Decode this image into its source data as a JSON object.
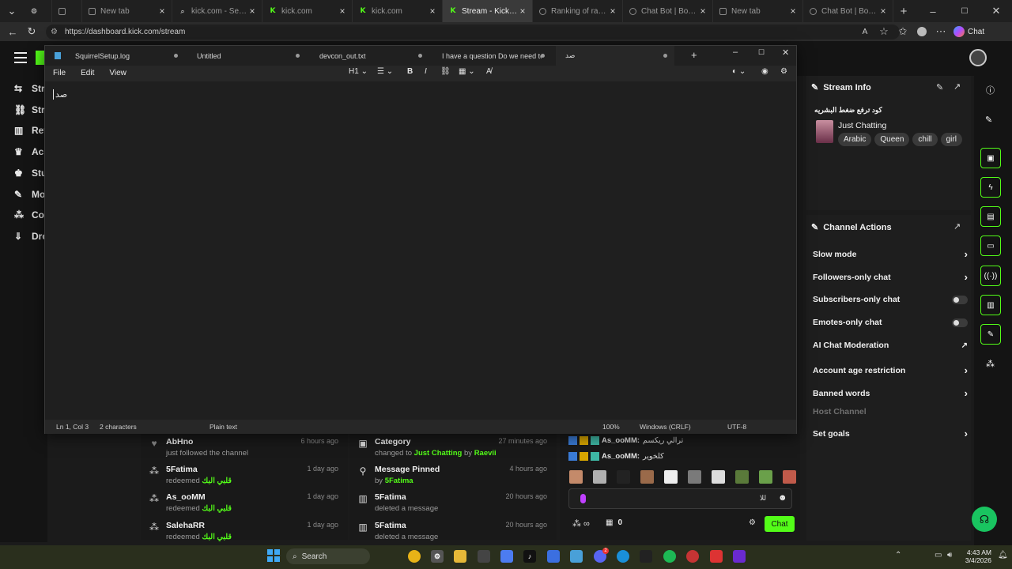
{
  "browser": {
    "tabs": [
      {
        "title": "",
        "icon": "gear-icon",
        "active": false
      },
      {
        "title": "",
        "icon": "doc-icon",
        "active": false
      },
      {
        "title": "New tab",
        "icon": "doc-icon",
        "active": false
      },
      {
        "title": "kick.com - Search",
        "icon": "search-icon",
        "active": false
      },
      {
        "title": "kick.com",
        "icon": "kick-icon",
        "active": false
      },
      {
        "title": "kick.com",
        "icon": "kick-icon",
        "active": false
      },
      {
        "title": "Stream - Kick Dashbo",
        "icon": "kick-icon",
        "active": true
      },
      {
        "title": "Ranking of raevii | Bo",
        "icon": "globe-icon",
        "active": false
      },
      {
        "title": "Chat Bot | BotRix — ",
        "icon": "globe-icon",
        "active": false
      },
      {
        "title": "New tab",
        "icon": "doc-icon",
        "active": false
      },
      {
        "title": "Chat Bot | BotRix — ",
        "icon": "globe-icon",
        "active": false
      }
    ],
    "url": "https://dashboard.kick.com/stream",
    "chat_button": "Chat",
    "reader_label": "A"
  },
  "left_nav": {
    "items": [
      {
        "label": "Stre",
        "icon": "stream-icon"
      },
      {
        "label": "Stre",
        "icon": "link-icon"
      },
      {
        "label": "Rev",
        "icon": "revenue-icon"
      },
      {
        "label": "Achi",
        "icon": "trophy-icon"
      },
      {
        "label": "Stud",
        "icon": "studio-icon"
      },
      {
        "label": "Mo",
        "icon": "wrench-icon"
      },
      {
        "label": "Com",
        "icon": "community-icon"
      },
      {
        "label": "Dro",
        "icon": "drops-icon"
      }
    ]
  },
  "notepad": {
    "tabs": [
      {
        "label": "SquirrelSetup.log"
      },
      {
        "label": "Untitled"
      },
      {
        "label": "devcon_out.txt"
      },
      {
        "label": "I have a question Do we need to kr"
      },
      {
        "label": "صد"
      }
    ],
    "menu": [
      "File",
      "Edit",
      "View"
    ],
    "heading_control": "H1",
    "content": "صد",
    "status": {
      "position": "Ln 1, Col 3",
      "characters": "2 characters",
      "format": "Plain text",
      "zoom": "100%",
      "line_endings": "Windows (CRLF)",
      "encoding": "UTF-8"
    }
  },
  "stream_info": {
    "header": "Stream Info",
    "title": "كود ترفع ضغط البشريه",
    "category": "Just Chatting",
    "tags": [
      "Arabic",
      "Queen",
      "chill",
      "girl"
    ]
  },
  "channel_actions": {
    "header": "Channel Actions",
    "items": [
      {
        "label": "Slow mode",
        "control": "chevron"
      },
      {
        "label": "Followers-only chat",
        "control": "chevron"
      },
      {
        "label": "Subscribers-only chat",
        "control": "toggle"
      },
      {
        "label": "Emotes-only chat",
        "control": "toggle"
      },
      {
        "label": "AI Chat Moderation",
        "control": "external"
      },
      {
        "label": "Account age restriction",
        "control": "chevron"
      },
      {
        "label": "Banned words",
        "control": "chevron"
      },
      {
        "label": "Host Channel",
        "control": "none"
      },
      {
        "label": "Set goals",
        "control": "chevron"
      }
    ]
  },
  "activity_feed": {
    "col1": [
      {
        "name": "AbHno",
        "action": "just followed the channel",
        "highlight": "",
        "time": "6 hours ago",
        "icon": "heart-icon"
      },
      {
        "name": "5Fatima",
        "action": "redeemed",
        "highlight": "قلبي البك",
        "time": "1 day ago",
        "icon": "redeem-icon"
      },
      {
        "name": "As_ooMM",
        "action": "redeemed",
        "highlight": "قلبي البك",
        "time": "1 day ago",
        "icon": "redeem-icon"
      },
      {
        "name": "SalehaRR",
        "action": "redeemed",
        "highlight": "قلبي البك",
        "time": "1 day ago",
        "icon": "redeem-icon"
      }
    ],
    "col2": [
      {
        "name": "Category",
        "action": "changed to",
        "highlight": "Just Chatting",
        "by": "by",
        "by_user": "Raevii",
        "time": "27 minutes ago",
        "icon": "category-icon"
      },
      {
        "name": "Message Pinned",
        "action": "by",
        "highlight": "5Fatima",
        "time": "4 hours ago",
        "icon": "pin-icon"
      },
      {
        "name": "5Fatima",
        "action": "deleted a message",
        "highlight": "",
        "time": "20 hours ago",
        "icon": "trash-icon"
      },
      {
        "name": "5Fatima",
        "action": "deleted a message",
        "highlight": "",
        "time": "20 hours ago",
        "icon": "trash-icon"
      }
    ]
  },
  "chat": {
    "messages": [
      {
        "user": "As_ooMM:",
        "text": "ترالي ريكسم"
      },
      {
        "user": "As_ooMM:",
        "text": "كلخوير"
      }
    ],
    "viewers": "0",
    "send_label": "Chat",
    "poll_label": "للا"
  },
  "taskbar": {
    "search_label": "Search",
    "time": "4:43 AM",
    "date": "3/4/2026",
    "notification_badge": "2"
  },
  "colors": {
    "kick_green": "#53fc18",
    "bg": "#1b1b1b"
  }
}
